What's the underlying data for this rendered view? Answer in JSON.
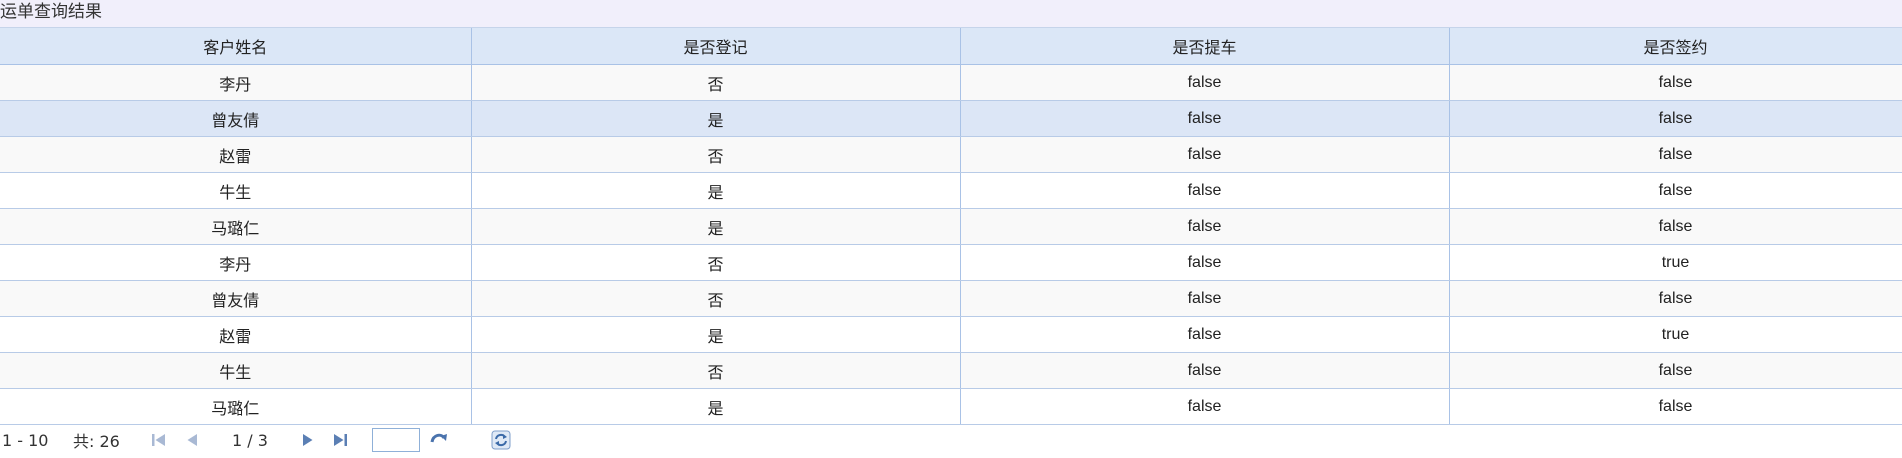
{
  "panel": {
    "title": "运单查询结果"
  },
  "columns": [
    "客户姓名",
    "是否登记",
    "是否提车",
    "是否签约"
  ],
  "rows": [
    {
      "name": "李丹",
      "registered": "否",
      "pickup": "false",
      "signed": "false"
    },
    {
      "name": "曾友倩",
      "registered": "是",
      "pickup": "false",
      "signed": "false"
    },
    {
      "name": "赵雷",
      "registered": "否",
      "pickup": "false",
      "signed": "false"
    },
    {
      "name": "牛生",
      "registered": "是",
      "pickup": "false",
      "signed": "false"
    },
    {
      "name": "马璐仁",
      "registered": "是",
      "pickup": "false",
      "signed": "false"
    },
    {
      "name": "李丹",
      "registered": "否",
      "pickup": "false",
      "signed": "true"
    },
    {
      "name": "曾友倩",
      "registered": "否",
      "pickup": "false",
      "signed": "false"
    },
    {
      "name": "赵雷",
      "registered": "是",
      "pickup": "false",
      "signed": "true"
    },
    {
      "name": "牛生",
      "registered": "否",
      "pickup": "false",
      "signed": "false"
    },
    {
      "name": "马璐仁",
      "registered": "是",
      "pickup": "false",
      "signed": "false"
    }
  ],
  "pager": {
    "range": "1 - 10",
    "total": "共: 26",
    "page_count": "1 / 3",
    "page_input": ""
  },
  "colors": {
    "header_bg": "#dbe7f7",
    "border": "#a9c2e6",
    "selected_row": "#dce6f6",
    "icon": "#5b7fb4"
  }
}
